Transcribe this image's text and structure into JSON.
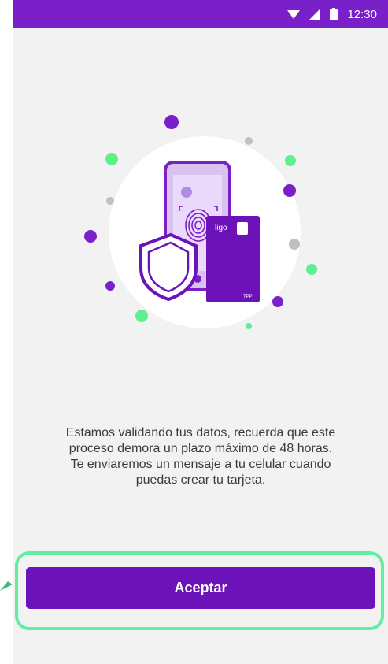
{
  "status_bar": {
    "time": "12:30",
    "background": "#7a20c8"
  },
  "illustration": {
    "card_brand": "ligo",
    "card_tag": "TPP",
    "icons": [
      "shield-icon",
      "fingerprint-icon",
      "phone-icon",
      "card-icon"
    ]
  },
  "message": {
    "line1": "Estamos validando tus datos, recuerda que este",
    "line2": "proceso demora un plazo máximo de 48 horas.",
    "line3": "Te enviaremos un mensaje a tu celular cuando",
    "line4": "puedas crear tu tarjeta."
  },
  "actions": {
    "accept_label": "Aceptar"
  },
  "colors": {
    "primary": "#6b12b8",
    "accent_green": "#5ef0a0",
    "background": "#f2f2f2"
  }
}
